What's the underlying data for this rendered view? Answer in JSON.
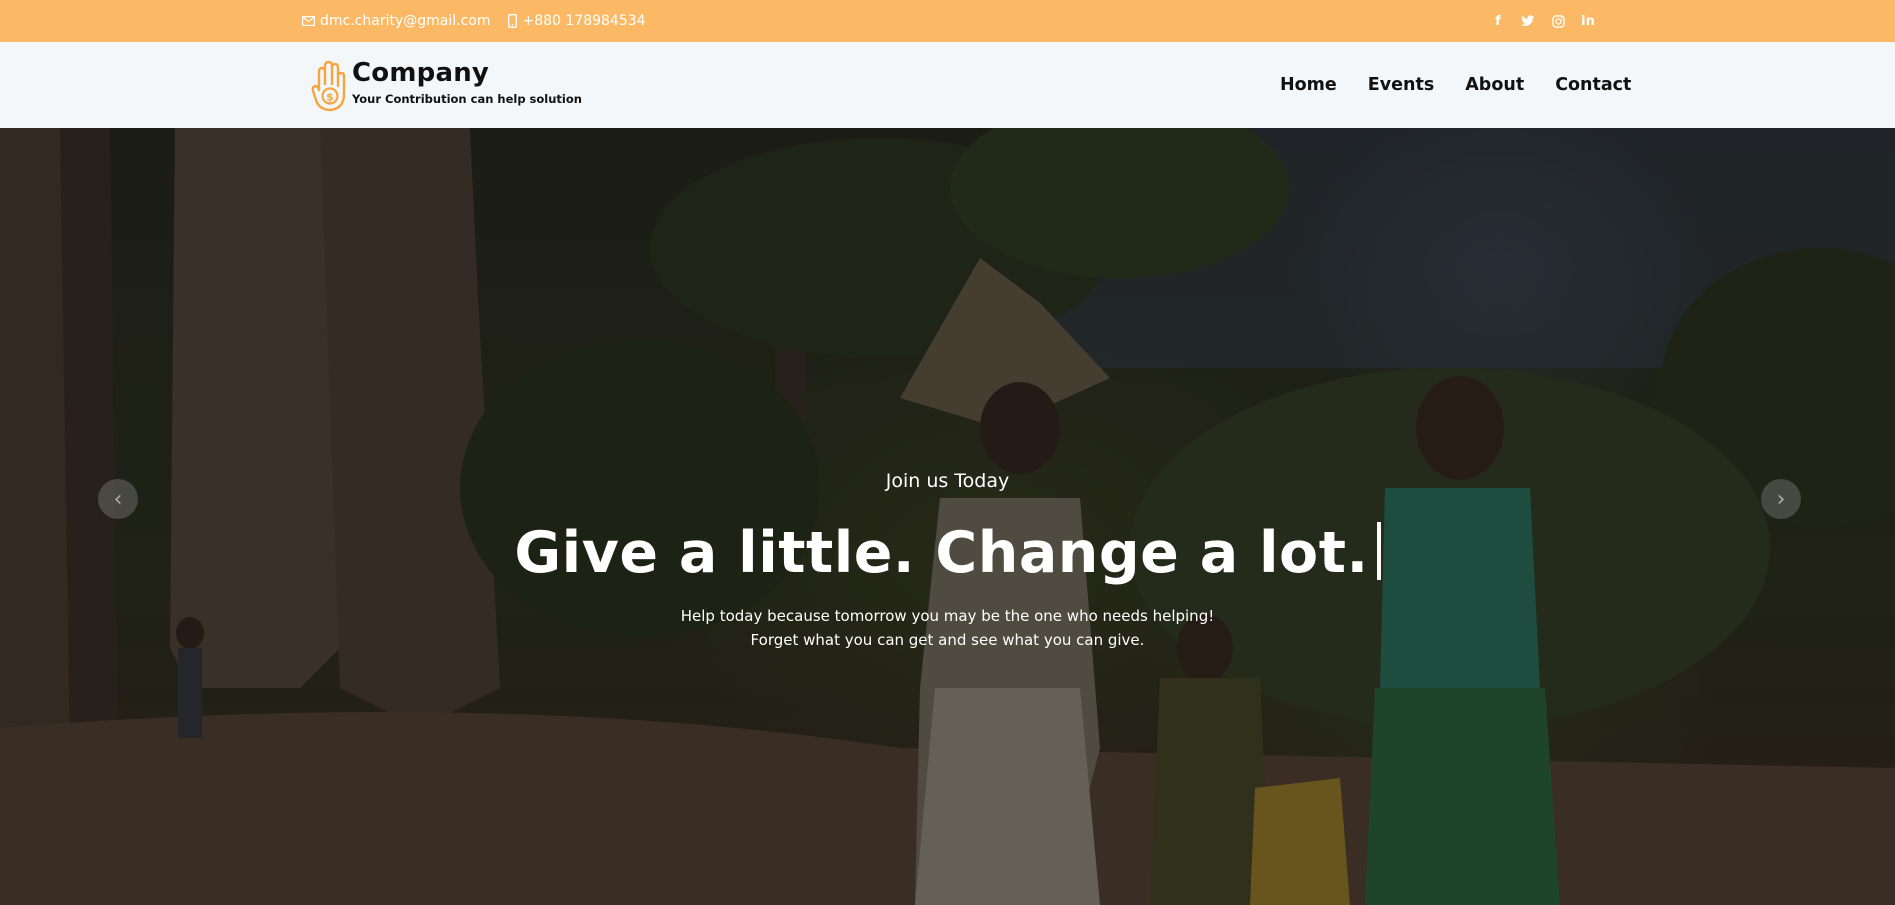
{
  "topbar": {
    "email": "dmc.charity@gmail.com",
    "phone": "+880 178984534",
    "email_icon": "envelope-icon",
    "phone_icon": "mobile-phone-icon",
    "social": [
      {
        "icon": "facebook-icon",
        "glyph": "f"
      },
      {
        "icon": "twitter-icon",
        "glyph": ""
      },
      {
        "icon": "instagram-icon",
        "glyph": ""
      },
      {
        "icon": "linkedin-icon",
        "glyph": "in"
      }
    ],
    "bg_color": "#fbb966"
  },
  "header": {
    "brand_name": "Company",
    "tagline": "Your Contribution can help solution",
    "logo_icon": "hand-coin-icon",
    "nav": [
      {
        "label": "Home"
      },
      {
        "label": "Events"
      },
      {
        "label": "About"
      },
      {
        "label": "Contact"
      }
    ]
  },
  "hero": {
    "kicker": "Join us Today",
    "headline": "Give a little. Change a lot.",
    "subtext_line1": "Help today because tomorrow you may be the one who needs helping!",
    "subtext_line2": "Forget what you can get and see what you can give.",
    "prev_label": "‹",
    "next_label": "›"
  }
}
